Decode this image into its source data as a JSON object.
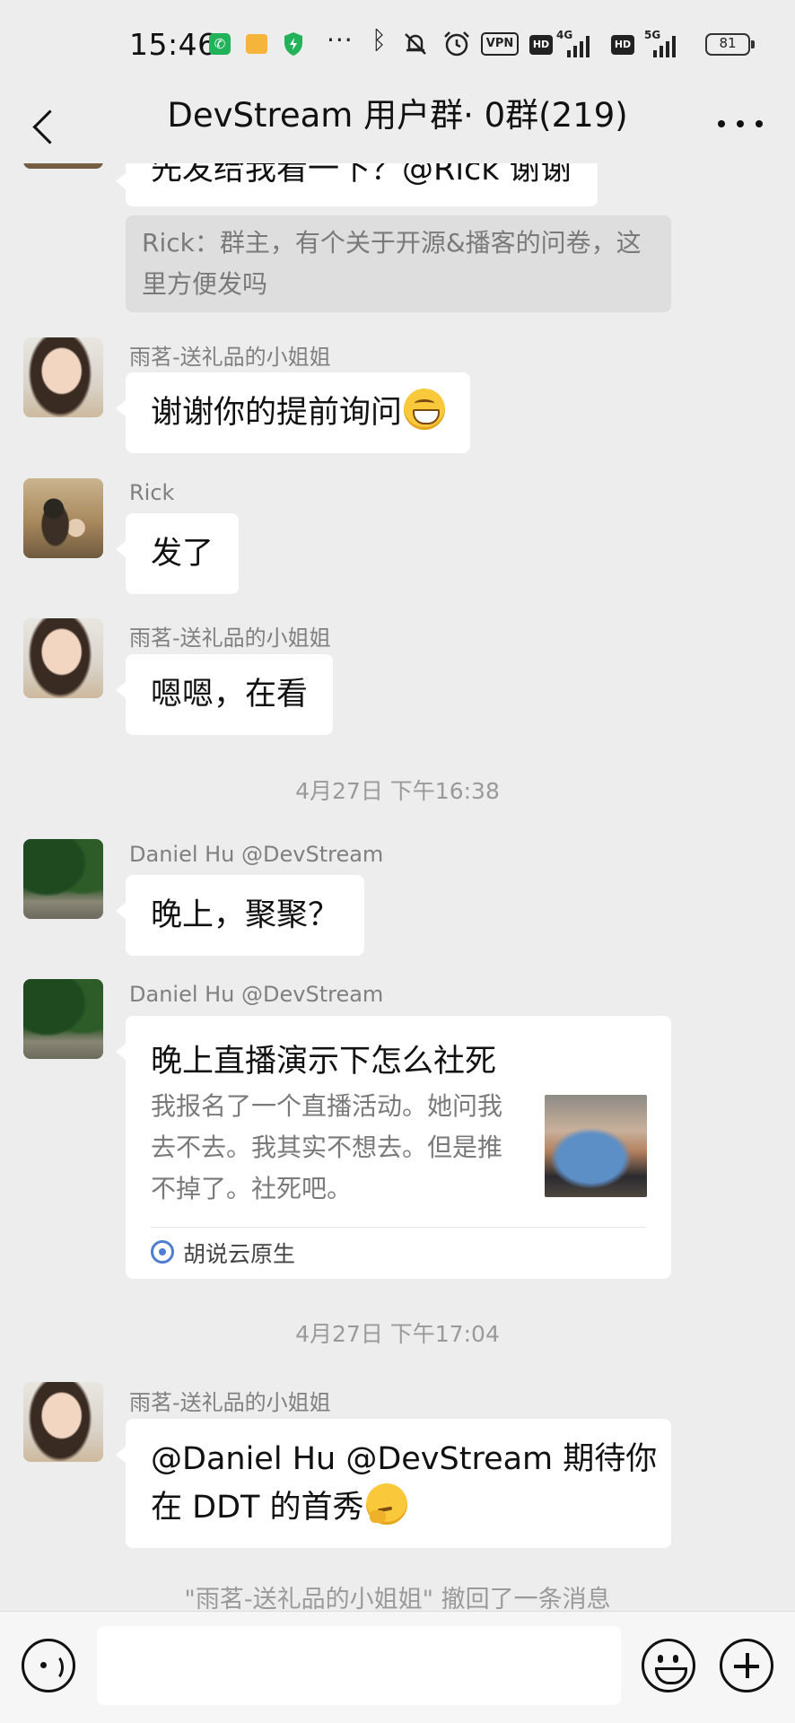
{
  "status_bar": {
    "time": "15:46",
    "more_dots": "···",
    "network_1": "4G",
    "network_2": "5G",
    "hd": "HD",
    "vpn": "VPN",
    "battery": "81"
  },
  "header": {
    "title": "DevStream 用户群· 0群(219)"
  },
  "messages": {
    "partial_text": "先发给我看一下？@Rick 谢谢",
    "quote": "Rick：群主，有个关于开源&播客的问卷，这里方便发吗",
    "m1": {
      "sender": "雨茗-送礼品的小姐姐",
      "text": "谢谢你的提前询问",
      "emoji": "grinning-face-emoji"
    },
    "m2": {
      "sender": "Rick",
      "text": "发了"
    },
    "m3": {
      "sender": "雨茗-送礼品的小姐姐",
      "text": "嗯嗯，在看"
    },
    "time_1": "4月27日 下午16:38",
    "m4": {
      "sender": "Daniel Hu @DevStream",
      "text": "晚上，聚聚？"
    },
    "m5": {
      "sender": "Daniel Hu @DevStream",
      "card_title": "晚上直播演示下怎么社死",
      "card_desc": "我报名了一个直播活动。她问我去不去。我其实不想去。但是推不掉了。社死吧。",
      "card_source": "胡说云原生"
    },
    "time_2": "4月27日 下午17:04",
    "m6": {
      "sender": "雨茗-送礼品的小姐姐",
      "line1": "@Daniel Hu @DevStream 期待你",
      "line2": "在 DDT 的首秀",
      "emoji": "thinking-face-emoji"
    },
    "recall_notice": "\"雨茗-送礼品的小姐姐\" 撤回了一条消息"
  },
  "input_bar": {
    "text_value": "",
    "voice_icon": "voice-icon",
    "emoji_icon": "emoji-icon",
    "plus_icon": "plus-icon"
  }
}
